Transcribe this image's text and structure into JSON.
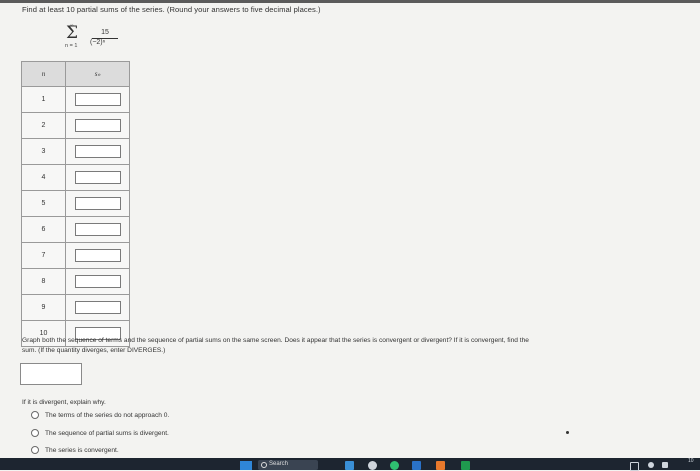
{
  "instruction": "Find at least 10 partial sums of the series. (Round your answers to five decimal places.)",
  "series": {
    "upper": "∞",
    "sigma": "Σ",
    "lower": "n = 1",
    "numerator": "15",
    "denominator": "(−2)ⁿ"
  },
  "table": {
    "header_n": "n",
    "header_s": "sₙ",
    "rows": [
      {
        "n": "1",
        "s": ""
      },
      {
        "n": "2",
        "s": ""
      },
      {
        "n": "3",
        "s": ""
      },
      {
        "n": "4",
        "s": ""
      },
      {
        "n": "5",
        "s": ""
      },
      {
        "n": "6",
        "s": ""
      },
      {
        "n": "7",
        "s": ""
      },
      {
        "n": "8",
        "s": ""
      },
      {
        "n": "9",
        "s": ""
      },
      {
        "n": "10",
        "s": ""
      }
    ]
  },
  "graph_question_line1": "Graph both the sequence of terms and the sequence of partial sums on the same screen. Does it appear that the series is convergent or divergent? If it is convergent, find the",
  "graph_question_line2": "sum. (If the quantity diverges, enter DIVERGES.)",
  "sum_answer": "",
  "divergent_prompt": "If it is divergent, explain why.",
  "options": [
    "The terms of the series do not approach 0.",
    "The sequence of partial sums is divergent.",
    "The series is convergent."
  ],
  "taskbar": {
    "search_label": "Search",
    "time": "10"
  }
}
